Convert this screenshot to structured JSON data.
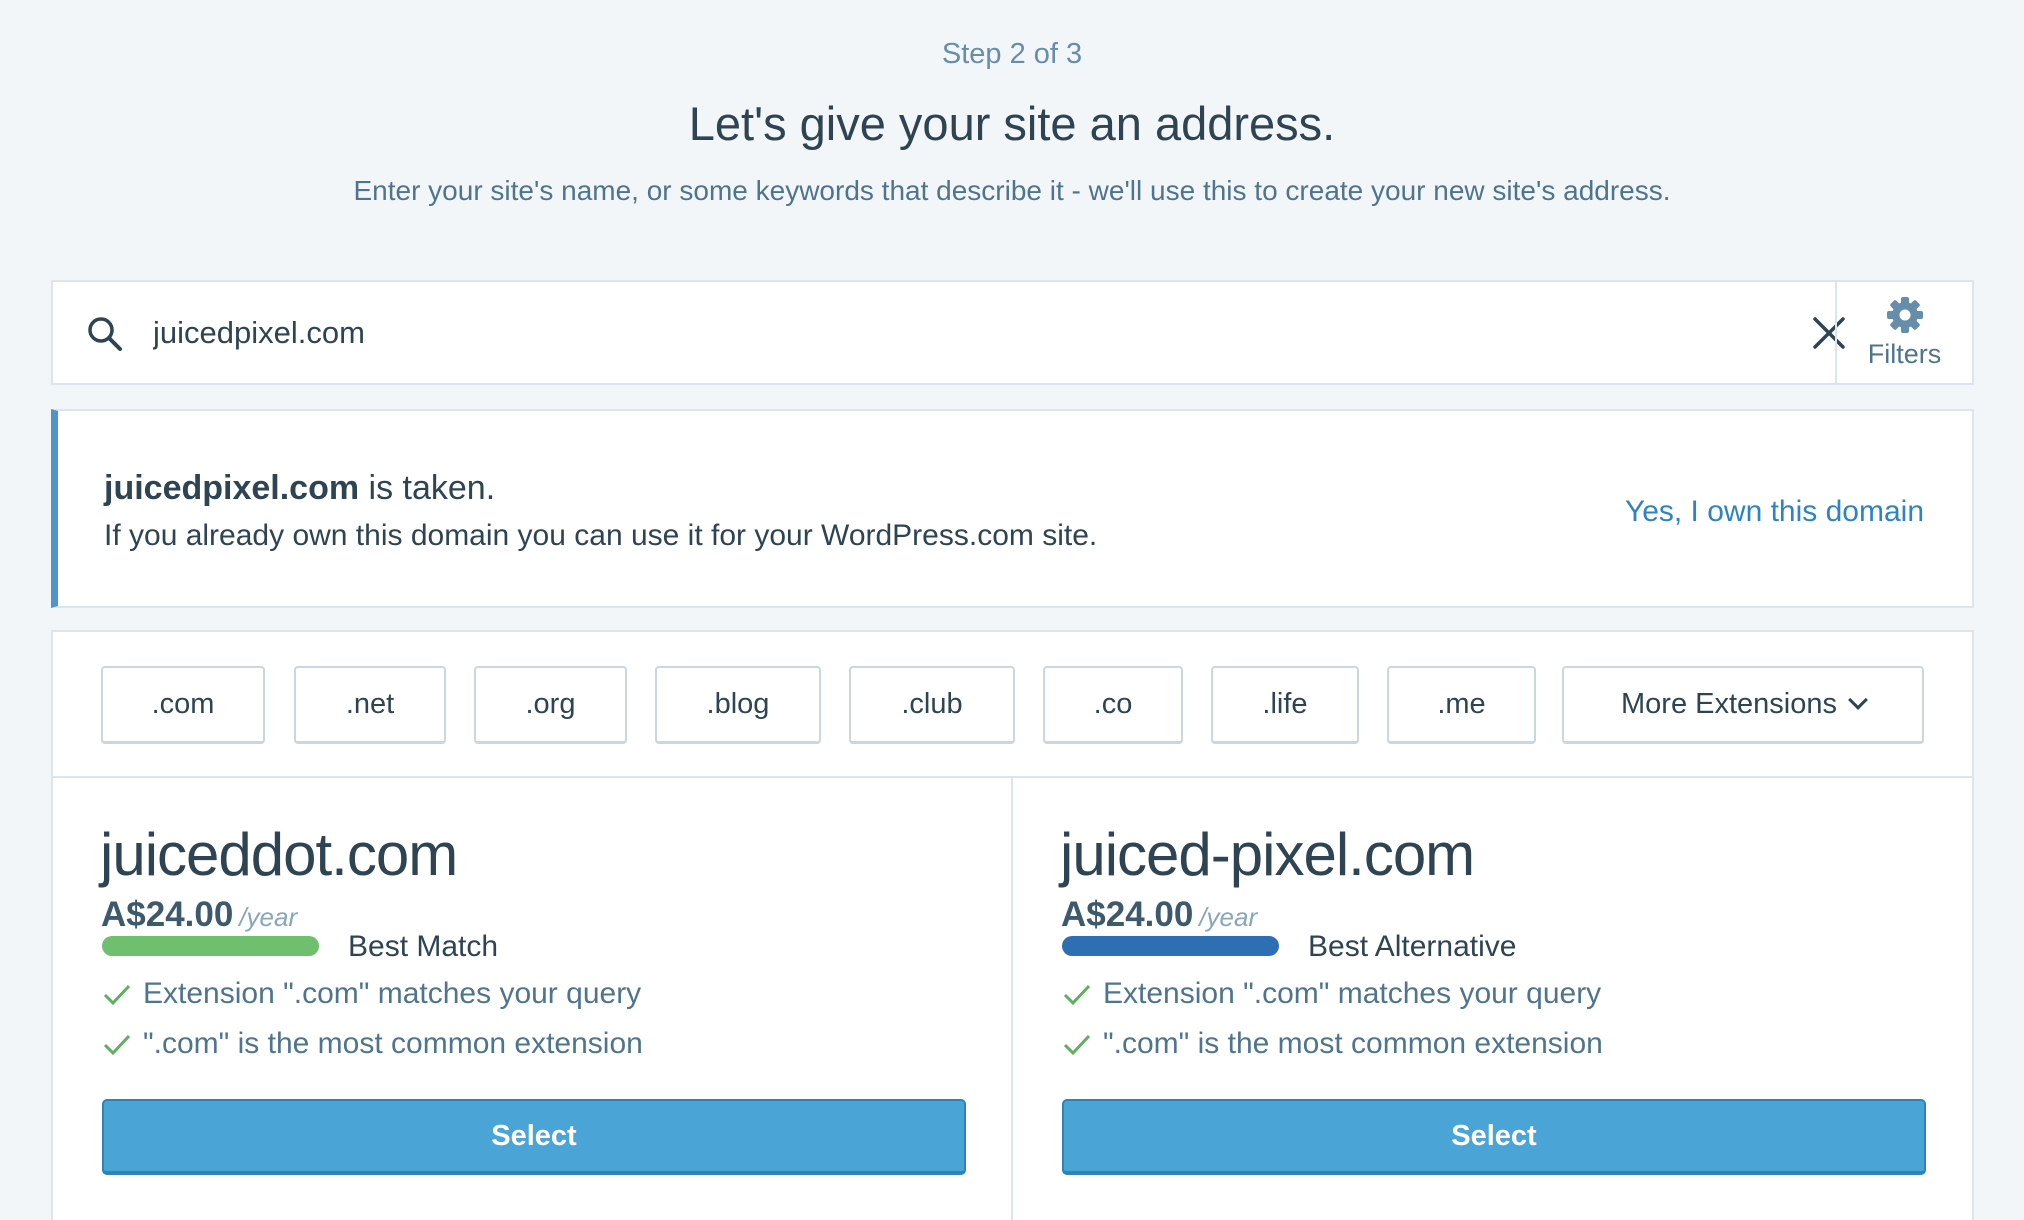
{
  "header": {
    "step": "Step 2 of 3",
    "title": "Let's give your site an address.",
    "subtitle": "Enter your site's name, or some keywords that describe it - we'll use this to create your new site's address."
  },
  "search": {
    "value": "juicedpixel.com",
    "filters_label": "Filters"
  },
  "notice": {
    "domain": "juicedpixel.com",
    "taken_text": " is taken.",
    "message": "If you already own this domain you can use it for your WordPress.com site.",
    "link": "Yes, I own this domain"
  },
  "tlds": [
    ".com",
    ".net",
    ".org",
    ".blog",
    ".club",
    ".co",
    ".life",
    ".me"
  ],
  "more_extensions": "More Extensions",
  "suggestions": [
    {
      "domain": "juiceddot.com",
      "price": "A$24.00",
      "period": "/year",
      "match_label": "Best Match",
      "match_color": "#6ebf6e",
      "reasons": [
        "Extension \".com\" matches your query",
        "\".com\" is the most common extension"
      ],
      "select_label": "Select"
    },
    {
      "domain": "juiced-pixel.com",
      "price": "A$24.00",
      "period": "/year",
      "match_label": "Best Alternative",
      "match_color": "#2e6fb3",
      "reasons": [
        "Extension \".com\" matches your query",
        "\".com\" is the most common extension"
      ],
      "select_label": "Select"
    }
  ],
  "colors": {
    "accent": "#2e83c4",
    "button": "#4aa4d6",
    "check": "#5fae62"
  }
}
